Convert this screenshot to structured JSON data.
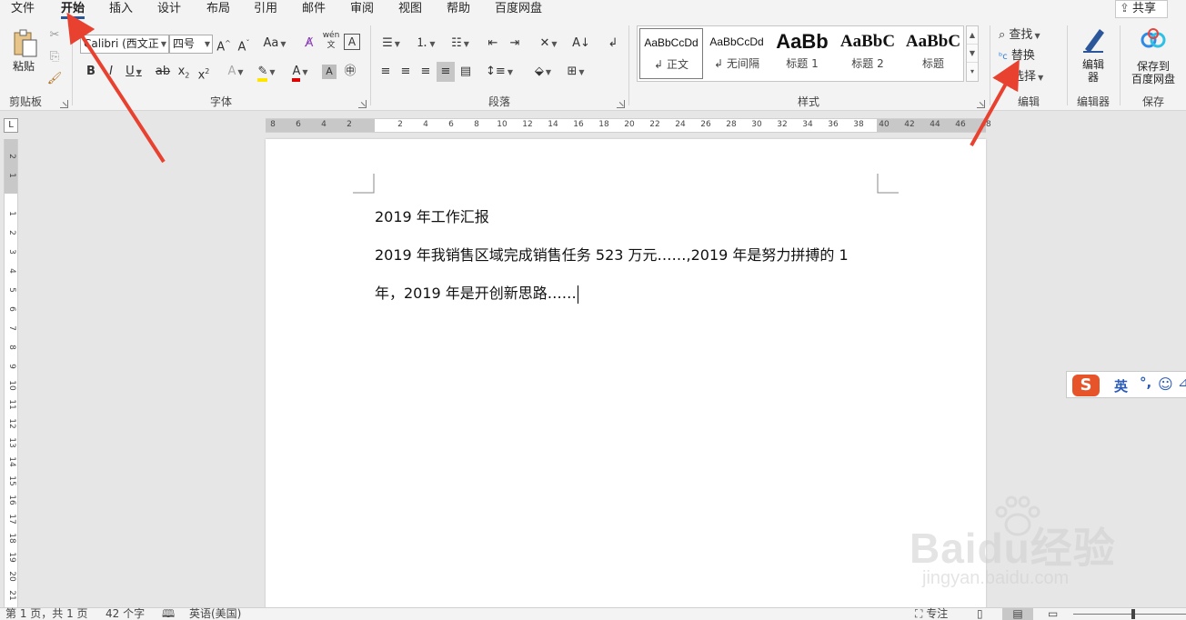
{
  "tabs": [
    "文件",
    "开始",
    "插入",
    "设计",
    "布局",
    "引用",
    "邮件",
    "审阅",
    "视图",
    "帮助",
    "百度网盘"
  ],
  "active_tab": "开始",
  "share": "共享",
  "clipboard": {
    "paste": "粘贴",
    "label": "剪贴板"
  },
  "font": {
    "name": "Calibri (西文正",
    "size": "四号",
    "label": "字体",
    "case": "Aa",
    "phonetic": "wén"
  },
  "paragraph": {
    "label": "段落"
  },
  "styles": {
    "label": "样式",
    "items": [
      {
        "sample": "AaBbCcDd",
        "name": "正文",
        "mark": "↲"
      },
      {
        "sample": "AaBbCcDd",
        "name": "无间隔",
        "mark": "↲"
      },
      {
        "sample": "AaBb",
        "name": "标题 1",
        "mark": ""
      },
      {
        "sample": "AaBbC",
        "name": "标题 2",
        "mark": ""
      },
      {
        "sample": "AaBbC",
        "name": "标题",
        "mark": ""
      }
    ]
  },
  "editing": {
    "find": "查找",
    "replace": "替换",
    "select": "选择",
    "label": "编辑"
  },
  "editor": {
    "button": "编辑器",
    "label": "编辑器"
  },
  "save": {
    "button_line1": "保存到",
    "button_line2": "百度网盘",
    "label": "保存"
  },
  "ruler_h": [
    "8",
    "6",
    "4",
    "2",
    "",
    "2",
    "4",
    "6",
    "8",
    "10",
    "12",
    "14",
    "16",
    "18",
    "20",
    "22",
    "24",
    "26",
    "28",
    "30",
    "32",
    "34",
    "36",
    "38",
    "40",
    "42",
    "44",
    "46",
    "48"
  ],
  "ruler_v": [
    "2",
    "1",
    "",
    "1",
    "2",
    "3",
    "4",
    "5",
    "6",
    "7",
    "8",
    "9",
    "10",
    "11",
    "12",
    "13",
    "14",
    "15",
    "16",
    "17",
    "18",
    "19",
    "20",
    "21"
  ],
  "ruler_corner": "L",
  "document": {
    "lines": [
      "2019 年工作汇报",
      "2019 年我销售区域完成销售任务 523 万元……,2019 年是努力拼搏的 1",
      "年，2019 年是开创新思路……"
    ]
  },
  "ime": {
    "logo": "S",
    "lang": "英",
    "punct": "°,",
    "emoji": "☺",
    "more": "⊿"
  },
  "status": {
    "page": "第 1 页，共 1 页",
    "words": "42 个字",
    "language": "英语(美国)",
    "focus": "专注"
  },
  "watermark": {
    "brand": "Baidu经验",
    "url": "jingyan.baidu.com"
  },
  "annotation_color": "#e8412f"
}
